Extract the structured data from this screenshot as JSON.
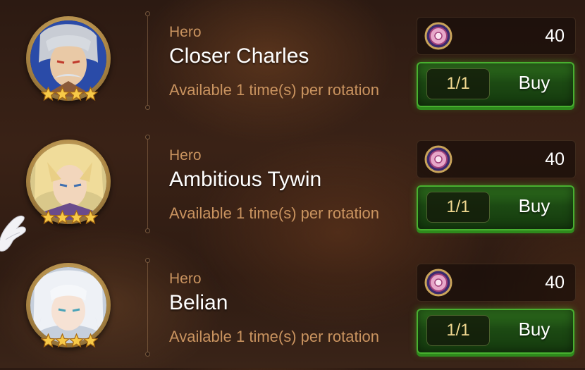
{
  "offers": [
    {
      "type_label": "Hero",
      "name": "Closer Charles",
      "availability": "Available 1 time(s) per rotation",
      "price": "40",
      "quantity": "1/1",
      "buy_label": "Buy",
      "stars": 4
    },
    {
      "type_label": "Hero",
      "name": "Ambitious Tywin",
      "availability": "Available 1 time(s) per rotation",
      "price": "40",
      "quantity": "1/1",
      "buy_label": "Buy",
      "stars": 4
    },
    {
      "type_label": "Hero",
      "name": "Belian",
      "availability": "Available 1 time(s) per rotation",
      "price": "40",
      "quantity": "1/1",
      "buy_label": "Buy",
      "stars": 4
    }
  ],
  "colors": {
    "accent_text": "#c9935f",
    "buy_green": "#2e6f1d",
    "quantity_text": "#f0d890"
  },
  "icons": {
    "currency": "gem-coin-icon",
    "rarity": "star-icon"
  }
}
